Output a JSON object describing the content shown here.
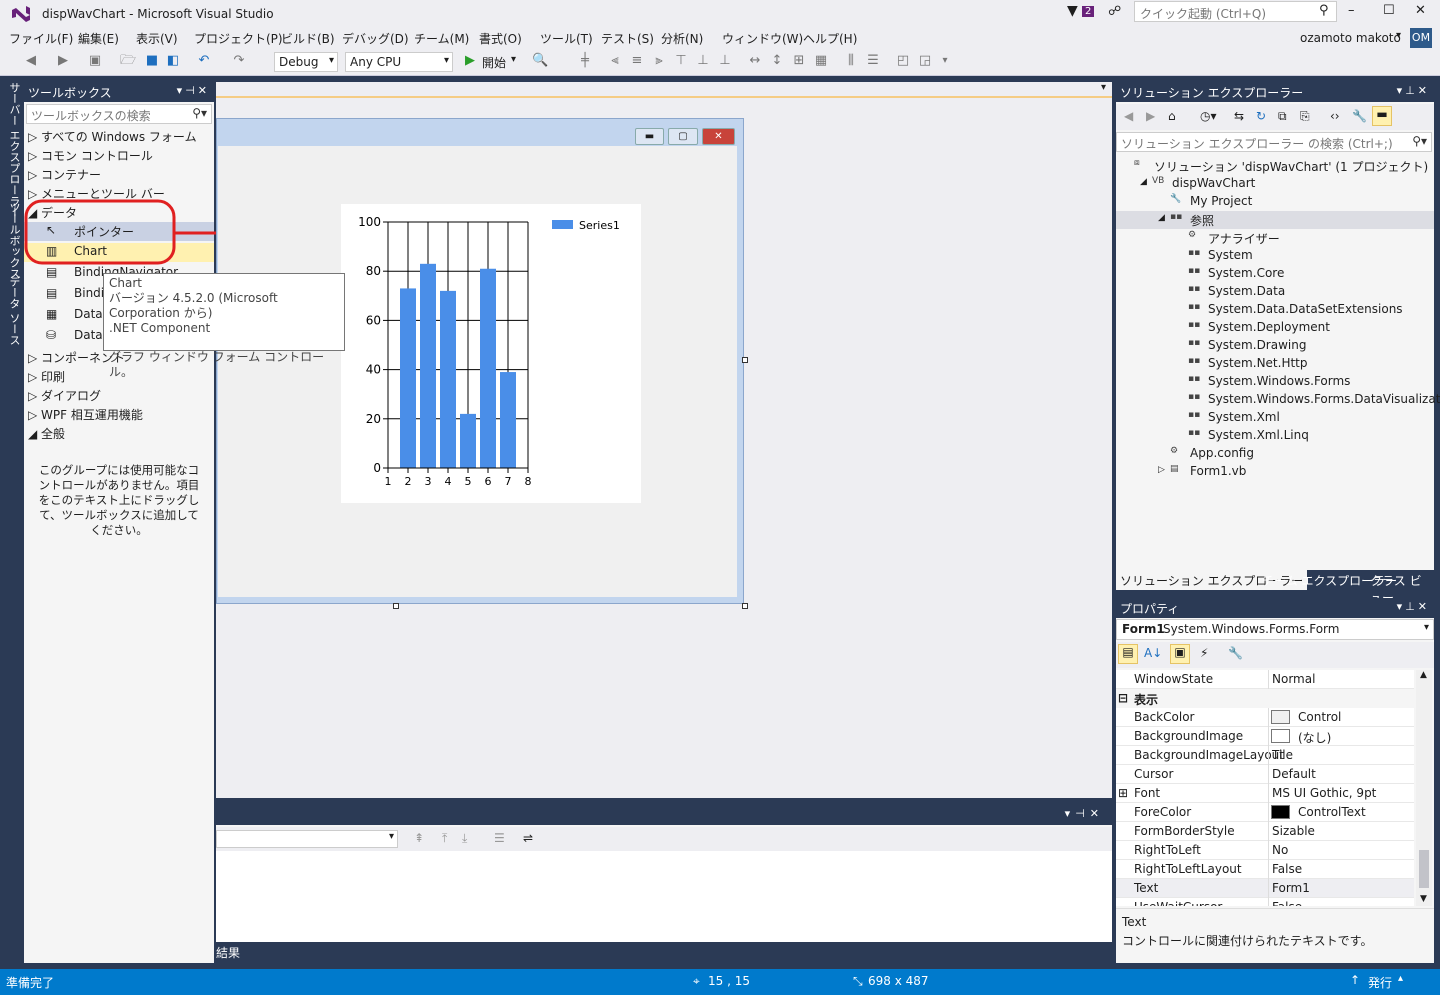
{
  "title": "dispWavChart - Microsoft Visual Studio",
  "notif_count": "2",
  "quick_launch_placeholder": "クイック起動 (Ctrl+Q)",
  "window_controls": {
    "min": "–",
    "max": "☐",
    "close": "✕"
  },
  "user": {
    "name": "ozamoto makoto",
    "initials": "OM"
  },
  "menu": [
    "ファイル(F)",
    "編集(E)",
    "表示(V)",
    "プロジェクト(P)",
    "ビルド(B)",
    "デバッグ(D)",
    "チーム(M)",
    "書式(O)",
    "ツール(T)",
    "テスト(S)",
    "分析(N)",
    "ウィンドウ(W)",
    "ヘルプ(H)"
  ],
  "toolbar": {
    "config": "Debug",
    "platform": "Any CPU",
    "start_label": "開始"
  },
  "left_tabs": [
    "サーバー エクスプローラー",
    "ツールボックス",
    "データ ソース"
  ],
  "toolbox": {
    "title": "ツールボックス",
    "search_placeholder": "ツールボックスの検索",
    "groups_top": [
      "すべての Windows フォーム",
      "コモン コントロール",
      "コンテナー",
      "メニューとツール バー"
    ],
    "data_group": "データ",
    "data_items": [
      "ポインター",
      "Chart",
      "BindingNavigator",
      "BindingSource",
      "DataGridView",
      "DataSet"
    ],
    "groups_bottom": [
      "コンポーネント",
      "印刷",
      "ダイアログ",
      "WPF 相互運用機能"
    ],
    "general_group": "全般",
    "empty_message": "このグループには使用可能なコントロールがありません。項目をこのテキスト上にドラッグして、ツールボックスに追加してください。"
  },
  "tooltip": {
    "name": "Chart",
    "version": "バージョン 4.5.2.0 (Microsoft Corporation から)",
    "component": ".NET Component",
    "description": "グラフ ウィンドウ フォーム コントロール。"
  },
  "annotation_color": "#e02020",
  "chart_data": {
    "type": "bar",
    "categories": [
      "2",
      "3",
      "4",
      "5",
      "6",
      "7"
    ],
    "values": [
      73,
      83,
      72,
      22,
      81,
      39
    ],
    "x_ticks": [
      "1",
      "2",
      "3",
      "4",
      "5",
      "6",
      "7",
      "8"
    ],
    "y_ticks": [
      "0",
      "20",
      "40",
      "60",
      "80",
      "100"
    ],
    "ylim": [
      0,
      100
    ],
    "xlim": [
      1,
      8
    ],
    "series": [
      {
        "name": "Series1",
        "values": [
          73,
          83,
          72,
          22,
          81,
          39
        ]
      }
    ],
    "legend": "top-right",
    "grid": true,
    "color": "#4a8ee8"
  },
  "output": {
    "tab_label": "結果"
  },
  "solution_explorer": {
    "title": "ソリューション エクスプローラー",
    "search_placeholder": "ソリューション エクスプローラー の検索 (Ctrl+;)",
    "tree": [
      {
        "label": "ソリューション 'dispWavChart' (1 プロジェクト)",
        "level": 0,
        "icon": "solution-icon",
        "expander": ""
      },
      {
        "label": "dispWavChart",
        "level": 1,
        "icon": "vb-project-icon",
        "expander": "◢"
      },
      {
        "label": "My Project",
        "level": 2,
        "icon": "wrench-icon",
        "expander": ""
      },
      {
        "label": "参照",
        "level": 2,
        "icon": "references-icon",
        "expander": "◢"
      },
      {
        "label": "アナライザー",
        "level": 3,
        "icon": "analyzer-icon",
        "expander": ""
      },
      {
        "label": "System",
        "level": 3,
        "icon": "reference-icon",
        "expander": ""
      },
      {
        "label": "System.Core",
        "level": 3,
        "icon": "reference-icon",
        "expander": ""
      },
      {
        "label": "System.Data",
        "level": 3,
        "icon": "reference-icon",
        "expander": ""
      },
      {
        "label": "System.Data.DataSetExtensions",
        "level": 3,
        "icon": "reference-icon",
        "expander": ""
      },
      {
        "label": "System.Deployment",
        "level": 3,
        "icon": "reference-icon",
        "expander": ""
      },
      {
        "label": "System.Drawing",
        "level": 3,
        "icon": "reference-icon",
        "expander": ""
      },
      {
        "label": "System.Net.Http",
        "level": 3,
        "icon": "reference-icon",
        "expander": ""
      },
      {
        "label": "System.Windows.Forms",
        "level": 3,
        "icon": "reference-icon",
        "expander": ""
      },
      {
        "label": "System.Windows.Forms.DataVisualization",
        "level": 3,
        "icon": "reference-icon",
        "expander": ""
      },
      {
        "label": "System.Xml",
        "level": 3,
        "icon": "reference-icon",
        "expander": ""
      },
      {
        "label": "System.Xml.Linq",
        "level": 3,
        "icon": "reference-icon",
        "expander": ""
      },
      {
        "label": "App.config",
        "level": 2,
        "icon": "config-icon",
        "expander": ""
      },
      {
        "label": "Form1.vb",
        "level": 2,
        "icon": "form-icon",
        "expander": "▷"
      }
    ],
    "bottom_tabs": [
      "ソリューション エクスプローラー",
      "チーム エクスプローラー",
      "クラス ビュー"
    ]
  },
  "properties": {
    "title": "プロパティ",
    "object_name": "Form1",
    "object_type": "System.Windows.Forms.Form",
    "category": "表示",
    "rows": [
      {
        "name": "WindowState",
        "value": "Normal"
      },
      {
        "name": "BackColor",
        "value": "Control",
        "swatch": "#f0f0f0"
      },
      {
        "name": "BackgroundImage",
        "value": "(なし)",
        "swatch": "#ffffff"
      },
      {
        "name": "BackgroundImageLayout",
        "value": "Tile"
      },
      {
        "name": "Cursor",
        "value": "Default"
      },
      {
        "name": "Font",
        "value": "MS UI Gothic, 9pt",
        "expander": "⊞"
      },
      {
        "name": "ForeColor",
        "value": "ControlText",
        "swatch": "#000000"
      },
      {
        "name": "FormBorderStyle",
        "value": "Sizable"
      },
      {
        "name": "RightToLeft",
        "value": "No"
      },
      {
        "name": "RightToLeftLayout",
        "value": "False"
      },
      {
        "name": "Text",
        "value": "Form1"
      },
      {
        "name": "UseWaitCursor",
        "value": "False"
      }
    ],
    "desc_title": "Text",
    "desc_text": "コントロールに関連付けられたテキストです。"
  },
  "status": {
    "ready": "準備完了",
    "position": "15 , 15",
    "size": "698 x 487",
    "publish": "発行"
  }
}
